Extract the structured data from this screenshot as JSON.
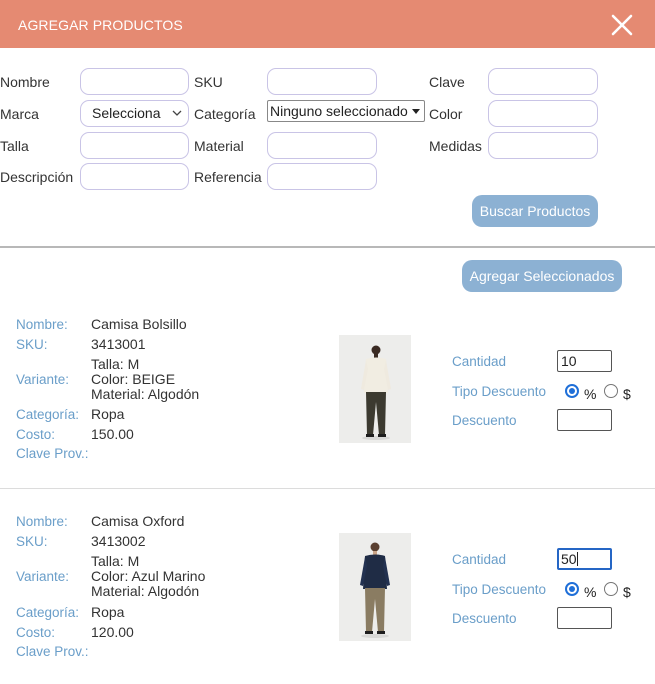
{
  "header": {
    "title": "AGREGAR PRODUCTOS",
    "close_icon": "close-icon"
  },
  "filters": {
    "nombre_label": "Nombre",
    "sku_label": "SKU",
    "clave_label": "Clave",
    "marca_label": "Marca",
    "marca_value": "Selecciona",
    "categoria_label": "Categoría",
    "categoria_value": "Ninguno seleccionado",
    "color_label": "Color",
    "talla_label": "Talla",
    "material_label": "Material",
    "medidas_label": "Medidas",
    "descripcion_label": "Descripción",
    "referencia_label": "Referencia",
    "search_button": "Buscar Productos"
  },
  "add_selected_button": "Agregar Seleccionados",
  "field_labels": {
    "nombre": "Nombre:",
    "sku": "SKU:",
    "variante": "Variante:",
    "categoria": "Categoría:",
    "costo": "Costo:",
    "clave_prov": "Clave Prov.:",
    "cantidad": "Cantidad",
    "tipo_descuento": "Tipo Descuento",
    "descuento": "Descuento",
    "percent": "%",
    "dollar": "$"
  },
  "products": [
    {
      "nombre": "Camisa Bolsillo",
      "sku": "3413001",
      "variante_talla": "Talla: M",
      "variante_color": "Color: BEIGE",
      "variante_material": "Material: Algodón",
      "categoria": "Ropa",
      "costo": "150.00",
      "clave_prov": "",
      "cantidad": "10",
      "tipo_descuento": "%",
      "descuento": ""
    },
    {
      "nombre": "Camisa Oxford",
      "sku": "3413002",
      "variante_talla": "Talla: M",
      "variante_color": "Color: Azul Marino",
      "variante_material": "Material: Algodón",
      "categoria": "Ropa",
      "costo": "120.00",
      "clave_prov": "",
      "cantidad": "50",
      "tipo_descuento": "%",
      "descuento": ""
    }
  ],
  "colors": {
    "header": "#e58a72",
    "button": "#8cb1d3",
    "key_text": "#6a9ec9",
    "radio_selected": "#1f6fd8"
  }
}
